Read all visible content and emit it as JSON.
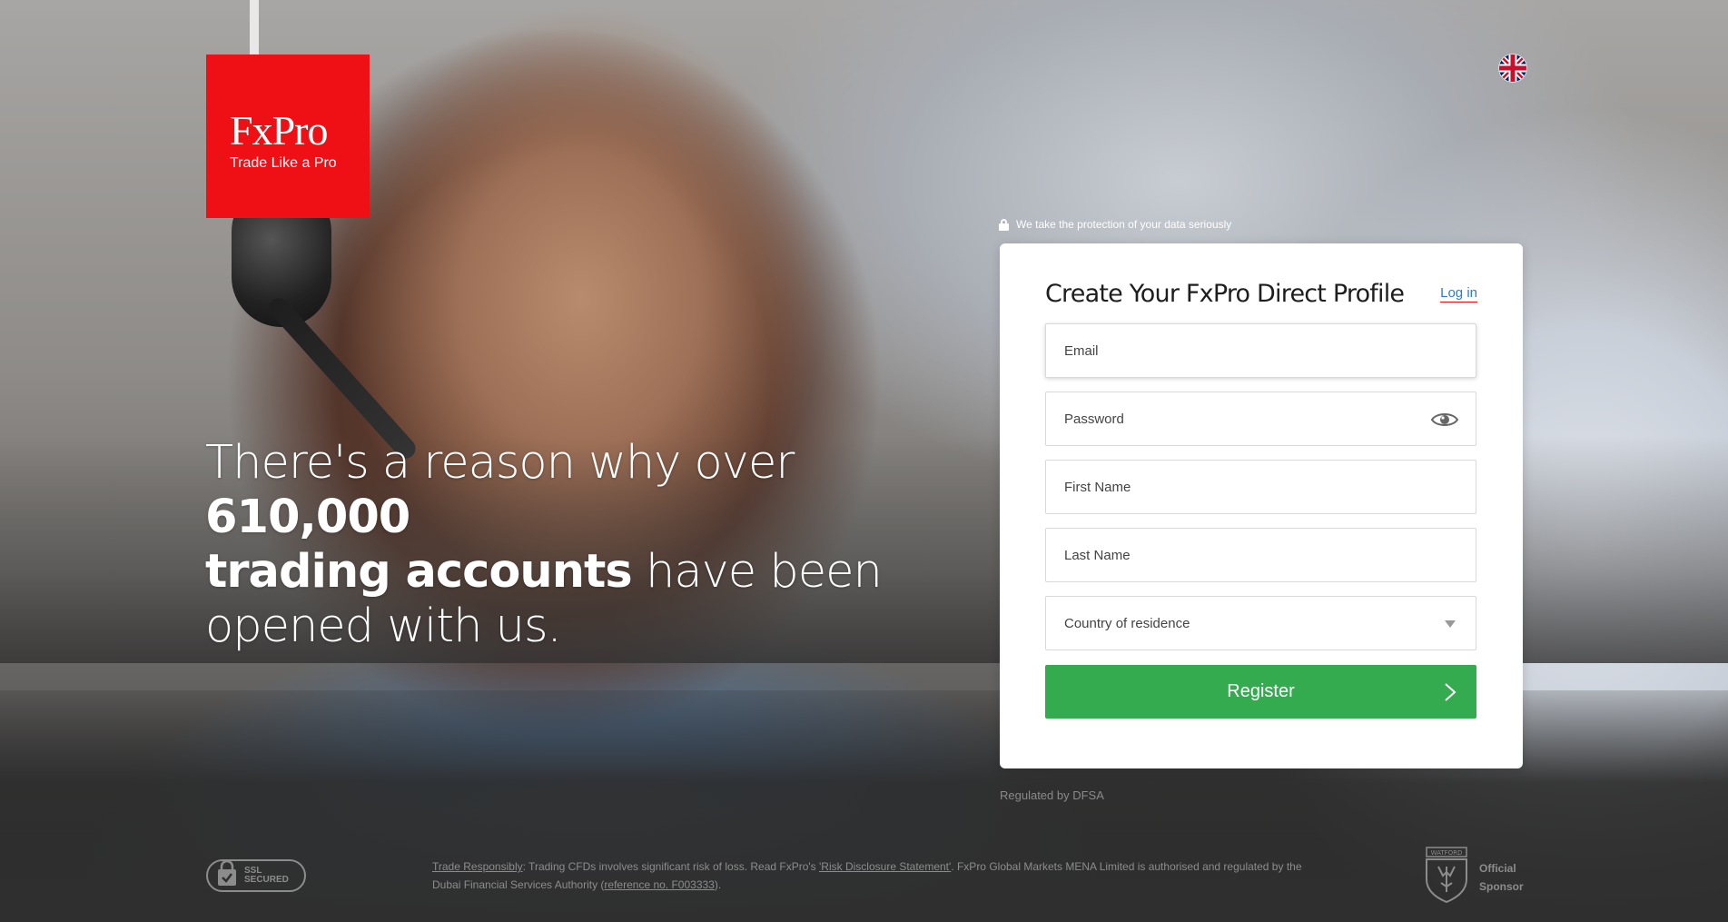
{
  "logo": {
    "brand": "FxPro",
    "tagline": "Trade Like a Pro",
    "bg_color": "#ef1015"
  },
  "language": {
    "icon": "uk-flag-icon"
  },
  "headline": {
    "part1": "There's a reason why over ",
    "bold1": "610,000",
    "bold2": "trading accounts",
    "part2": " have been opened with us."
  },
  "protection_note": "We take the protection of your data seriously",
  "form": {
    "title": "Create Your FxPro Direct Profile",
    "login_label": "Log in",
    "email_placeholder": "Email",
    "password_placeholder": "Password",
    "first_name_placeholder": "First Name",
    "last_name_placeholder": "Last Name",
    "country_placeholder": "Country of residence",
    "register_label": "Register",
    "register_color": "#34ab4e"
  },
  "regulated": "Regulated by DFSA",
  "footer": {
    "ssl_line1": "SSL",
    "ssl_line2": "SECURED",
    "trade_responsibly": "Trade Responsibly",
    "text1": ": Trading CFDs involves significant risk of loss. Read FxPro's ",
    "risk_link": "'Risk Disclosure Statement'",
    "text2": ". FxPro Global Markets MENA Limited is authorised and regulated by the Dubai Financial Services Authority (",
    "ref_link": "reference no. F003333",
    "text3": ").",
    "sponsor_line1": "Official",
    "sponsor_line2": "Sponsor",
    "sponsor_badge": "WATFORD"
  }
}
